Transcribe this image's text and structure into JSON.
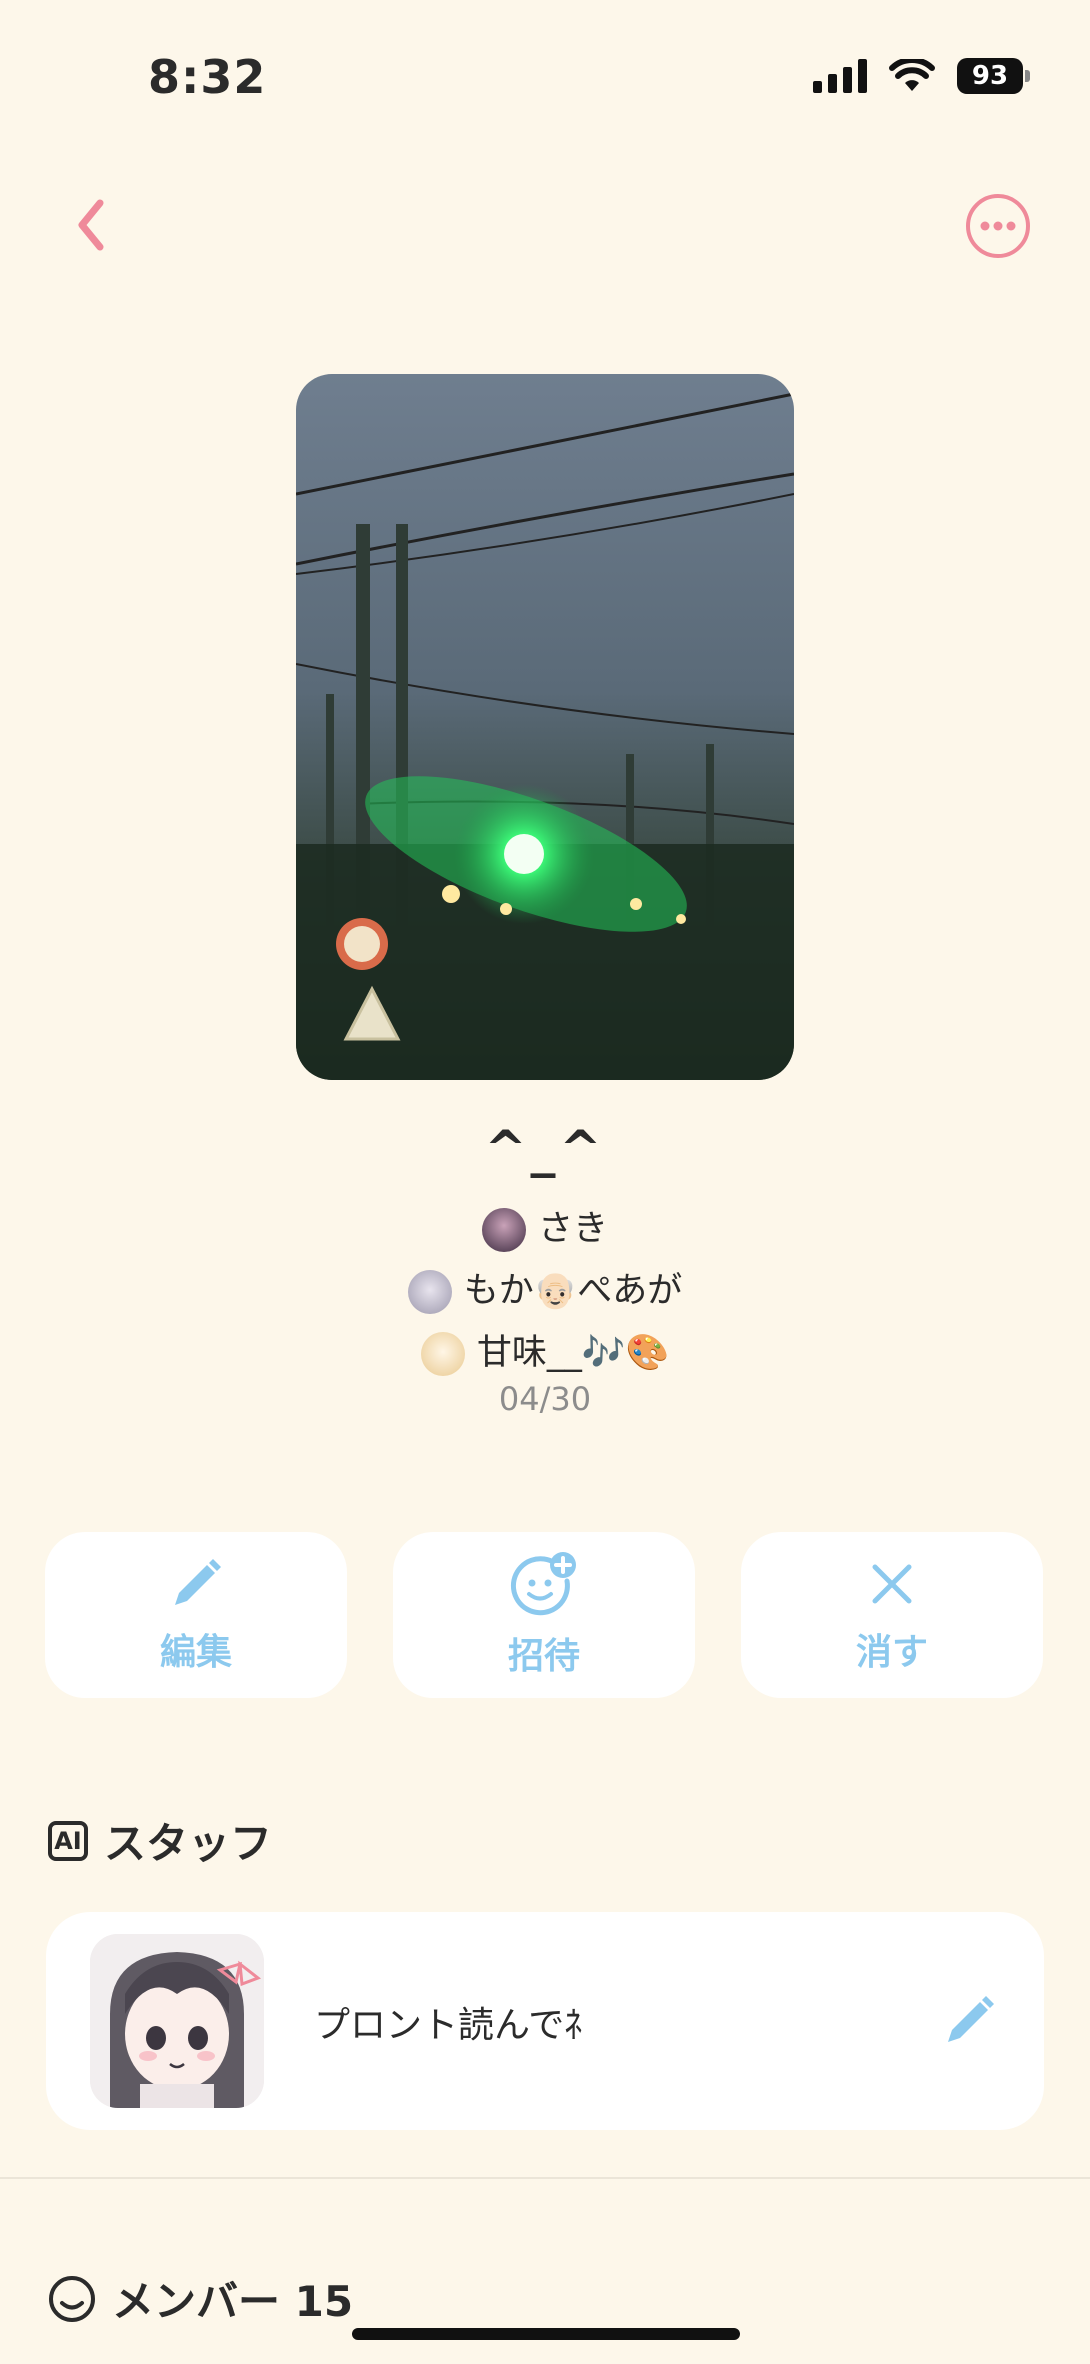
{
  "status_bar": {
    "time": "8:32",
    "battery": "93"
  },
  "post": {
    "title": "^_^",
    "members_lines": [
      {
        "names": "さき"
      },
      {
        "names": "もか👴🏻ぺあが"
      },
      {
        "names": "甘味__🎶🎨"
      }
    ],
    "date": "04/30"
  },
  "actions": {
    "edit_label": "編集",
    "invite_label": "招待",
    "delete_label": "消す"
  },
  "staff_section": {
    "badge": "AI",
    "title": "スタッフ",
    "prompt_text": "プロント読んでﾈ"
  },
  "members_section": {
    "title": "メンバー 15"
  },
  "colors": {
    "background": "#fdf7ea",
    "accent_pink": "#ef8a9a",
    "accent_blue": "#8cc9ee"
  }
}
